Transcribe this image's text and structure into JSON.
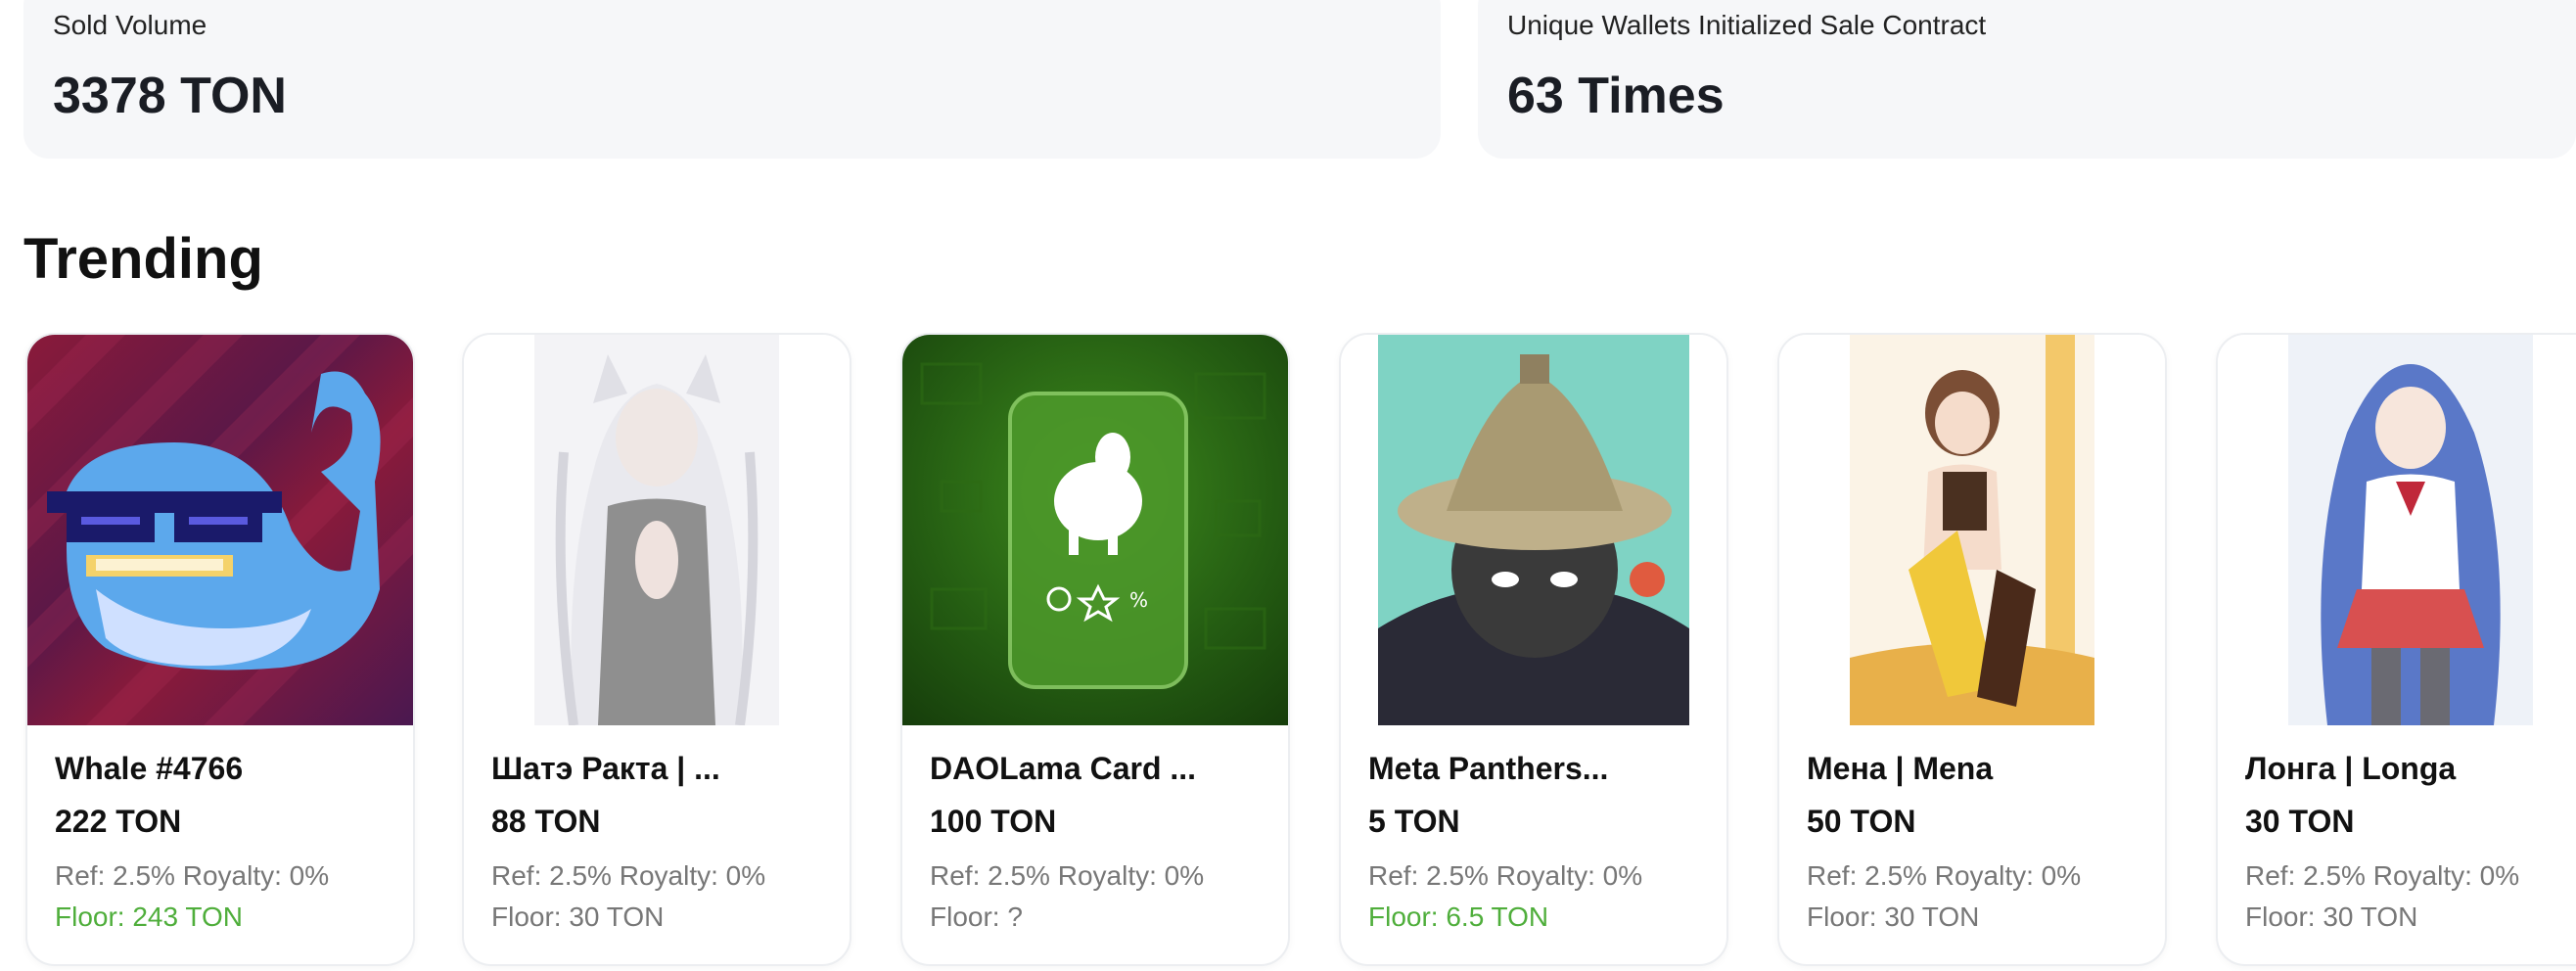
{
  "stats": [
    {
      "label": "Sold Volume",
      "value": "3378 TON"
    },
    {
      "label": "Unique Wallets Initialized Sale Contract",
      "value": "63 Times"
    }
  ],
  "section_title": "Trending",
  "cards": [
    {
      "name": "Whale #4766",
      "price": "222 TON",
      "meta": "Ref: 2.5% Royalty: 0%",
      "floor": "Floor: 243 TON",
      "floor_color": "#4fae3b"
    },
    {
      "name": "Шатэ Ракта | ...",
      "price": "88 TON",
      "meta": "Ref: 2.5% Royalty: 0%",
      "floor": "Floor: 30 TON",
      "floor_color": "#777777"
    },
    {
      "name": "DAOLama Card ...",
      "price": "100 TON",
      "meta": "Ref: 2.5% Royalty: 0%",
      "floor": "Floor: ?",
      "floor_color": "#777777"
    },
    {
      "name": "Meta Panthers...",
      "price": "5 TON",
      "meta": "Ref: 2.5% Royalty: 0%",
      "floor": "Floor: 6.5 TON",
      "floor_color": "#4fae3b"
    },
    {
      "name": "Мена | Mena",
      "price": "50 TON",
      "meta": "Ref: 2.5% Royalty: 0%",
      "floor": "Floor: 30 TON",
      "floor_color": "#777777"
    },
    {
      "name": "Лонга | Longa",
      "price": "30 TON",
      "meta": "Ref: 2.5% Royalty: 0%",
      "floor": "Floor: 30 TON",
      "floor_color": "#777777"
    }
  ]
}
